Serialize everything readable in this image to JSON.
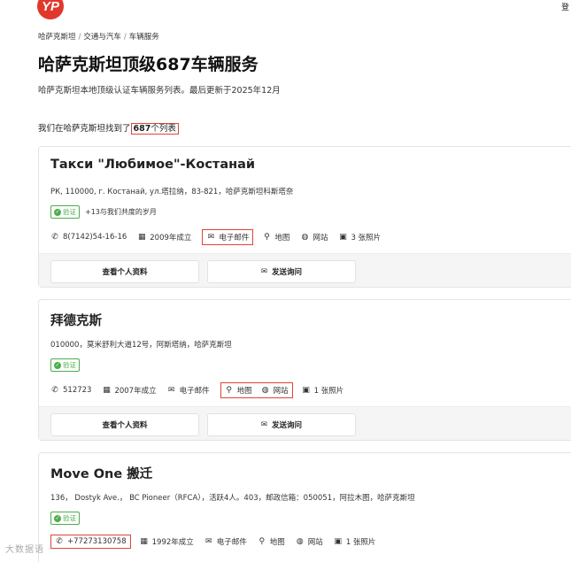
{
  "header": {
    "logo_text": "YP",
    "login": "登"
  },
  "breadcrumb": [
    "哈萨克斯坦",
    "交通与汽车",
    "车辆服务"
  ],
  "title": "哈萨克斯坦顶级687车辆服务",
  "subtitle": "哈萨克斯坦本地顶级认证车辆服务列表。最后更新于2025年12月",
  "count": {
    "prefix": "我们在哈萨克斯坦找到了",
    "number": "687",
    "suffix": "个列表"
  },
  "buttons": {
    "profile": "查看个人资料",
    "inquiry": "发送询问"
  },
  "listings": [
    {
      "name": "Такси \"Любимое\"-Костанай",
      "address": "РК, 110000, г. Костанай, ул.塔拉纳，83-821，哈萨克斯坦科斯塔奈",
      "verified": "验证",
      "years": "+13与我们共度的岁月",
      "phone": "8(7142)54-16-16",
      "founded": "2009年成立",
      "email": "电子邮件",
      "map": "地图",
      "website": "网站",
      "photos": "3 张照片"
    },
    {
      "name": "拜德克斯",
      "address": "010000，莫米舒利大道12号，阿斯塔纳，哈萨克斯坦",
      "verified": "验证",
      "phone": "512723",
      "founded": "2007年成立",
      "email": "电子邮件",
      "map": "地图",
      "website": "网站",
      "photos": "1 张照片"
    },
    {
      "name": "Move One 搬迁",
      "address": "136， Dostyk Ave.， BC Pioneer（RFCA），活跃4人。403，邮政信箱：050051，阿拉木图，哈萨克斯坦",
      "verified": "验证",
      "phone": "+77273130758",
      "founded": "1992年成立",
      "email": "电子邮件",
      "map": "地图",
      "website": "网站",
      "photos": "1 张照片"
    }
  ],
  "watermark": "大数据语"
}
